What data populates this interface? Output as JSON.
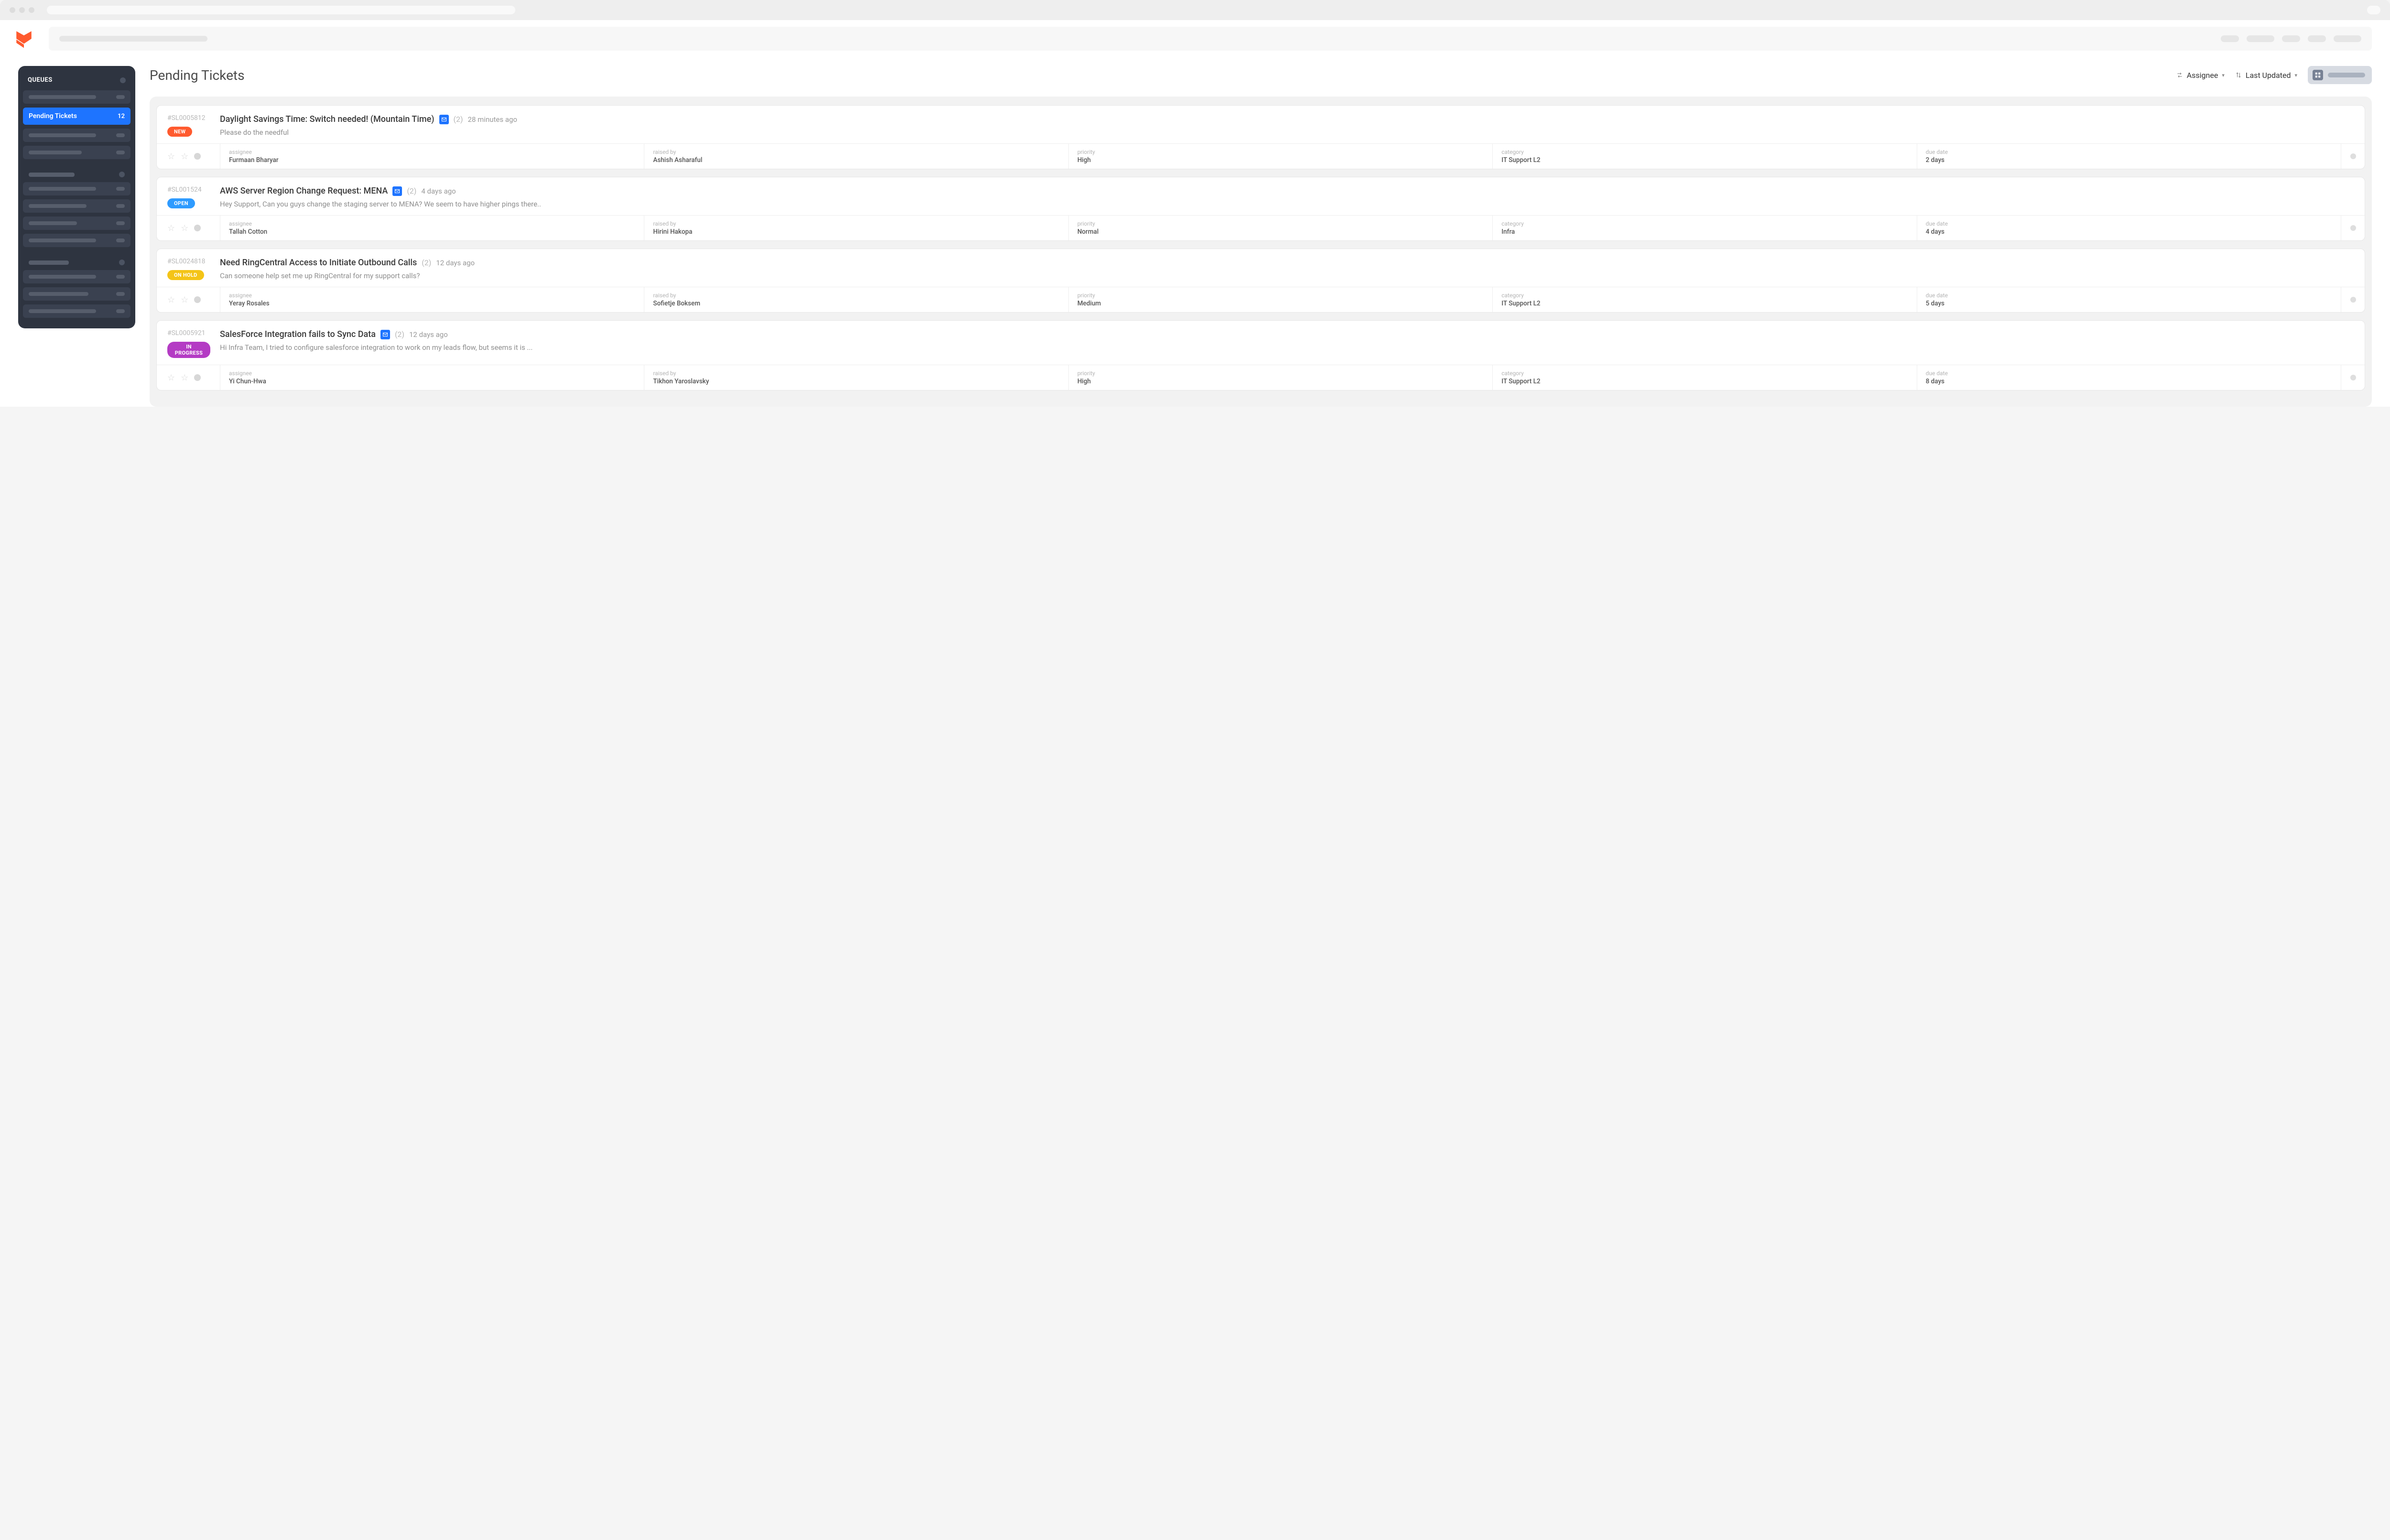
{
  "sidebar": {
    "heading": "QUEUES",
    "active": {
      "label": "Pending Tickets",
      "count": "12"
    }
  },
  "page": {
    "title": "Pending Tickets",
    "group_by": "Assignee",
    "sort_by": "Last Updated"
  },
  "meta_labels": {
    "assignee": "assignee",
    "raised_by": "raised by",
    "priority": "priority",
    "category": "category",
    "due_date": "due date"
  },
  "tickets": [
    {
      "id": "#SL0005812",
      "status": "NEW",
      "status_class": "status-new",
      "title": "Daylight Savings Time: Switch needed! (Mountain Time)",
      "has_mail": true,
      "replies": "(2)",
      "age": "28 minutes ago",
      "preview": "Please do the needful",
      "assignee": "Furmaan Bharyar",
      "raised_by": "Ashish Asharaful",
      "priority": "High",
      "category": "IT Support L2",
      "due_date": "2 days"
    },
    {
      "id": "#SL001524",
      "status": "OPEN",
      "status_class": "status-open",
      "title": "AWS Server Region Change Request: MENA",
      "has_mail": true,
      "replies": "(2)",
      "age": "4 days ago",
      "preview": "Hey Support, Can you guys change the staging server to MENA? We seem to have higher pings there..",
      "assignee": "Tallah Cotton",
      "raised_by": "Hirini Hakopa",
      "priority": "Normal",
      "category": "Infra",
      "due_date": "4 days"
    },
    {
      "id": "#SL0024818",
      "status": "ON HOLD",
      "status_class": "status-onhold",
      "title": "Need RingCentral Access to Initiate Outbound Calls",
      "has_mail": false,
      "replies": "(2)",
      "age": "12 days ago",
      "preview": "Can someone help set me up RingCentral for my support calls?",
      "assignee": "Yeray Rosales",
      "raised_by": "Sofietje Boksem",
      "priority": "Medium",
      "category": "IT Support L2",
      "due_date": "5 days"
    },
    {
      "id": "#SL0005921",
      "status": "IN PROGRESS",
      "status_class": "status-inprogress",
      "title": "SalesForce Integration fails to Sync Data",
      "has_mail": true,
      "replies": "(2)",
      "age": "12 days ago",
      "preview": "Hi Infra Team, I tried to configure salesforce integration to work on my leads flow, but seems it is ...",
      "assignee": "Yi Chun-Hwa",
      "raised_by": "Tikhon Yaroslavsky",
      "priority": "High",
      "category": "IT Support L2",
      "due_date": "8 days"
    }
  ]
}
